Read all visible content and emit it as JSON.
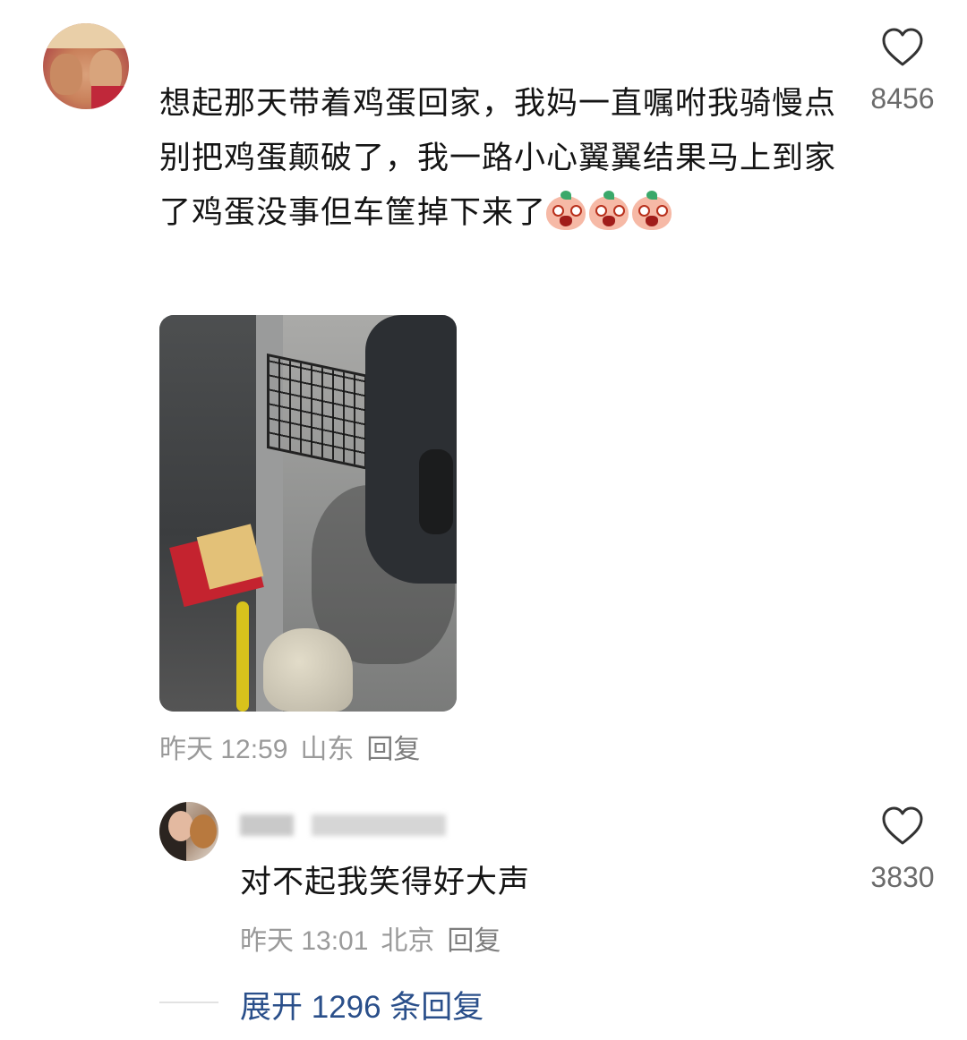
{
  "main_comment": {
    "text": "想起那天带着鸡蛋回家，我妈一直嘱咐我骑慢点别把鸡蛋颠破了，我一路小心翼翼结果马上到家了鸡蛋没事但车筐掉下来了",
    "emoji_count": 3,
    "likes": "8456",
    "time": "昨天 12:59",
    "location": "山东",
    "reply_label": "回复"
  },
  "reply_comment": {
    "text": "对不起我笑得好大声",
    "likes": "3830",
    "time": "昨天 13:01",
    "location": "北京",
    "reply_label": "回复"
  },
  "expand": {
    "label": "展开 1296 条回复"
  },
  "colors": {
    "text": "#141414",
    "meta": "#9a9a9a",
    "link": "#2a4f8a",
    "like_icon": "#333333"
  }
}
